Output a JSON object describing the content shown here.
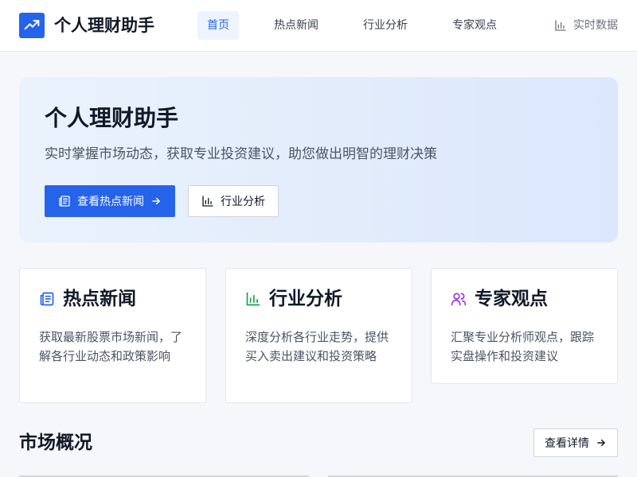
{
  "header": {
    "app_title": "个人理财助手",
    "nav": [
      {
        "label": "首页",
        "active": true
      },
      {
        "label": "热点新闻",
        "active": false
      },
      {
        "label": "行业分析",
        "active": false
      },
      {
        "label": "专家观点",
        "active": false
      }
    ],
    "realtime_label": "实时数据"
  },
  "hero": {
    "title": "个人理财助手",
    "subtitle": "实时掌握市场动态，获取专业投资建议，助您做出明智的理财决策",
    "primary_button": "查看热点新闻",
    "secondary_button": "行业分析"
  },
  "cards": [
    {
      "title": "热点新闻",
      "desc": "获取最新股票市场新闻，了解各行业动态和政策影响",
      "icon": "newspaper-icon",
      "color": "#2563eb"
    },
    {
      "title": "行业分析",
      "desc": "深度分析各行业走势，提供买入卖出建议和投资策略",
      "icon": "bar-chart-icon",
      "color": "#16a34a"
    },
    {
      "title": "专家观点",
      "desc": "汇聚专业分析师观点，跟踪实盘操作和投资建议",
      "icon": "users-icon",
      "color": "#9333ea"
    }
  ],
  "market": {
    "title": "市场概况",
    "details_button": "查看详情"
  },
  "colors": {
    "primary": "#2563eb",
    "background": "#f5f7fa"
  }
}
